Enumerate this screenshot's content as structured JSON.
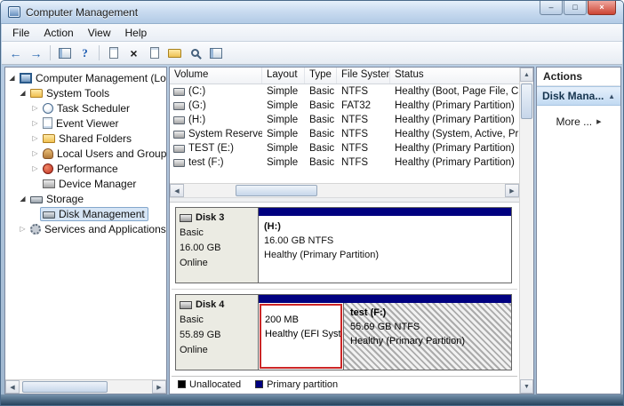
{
  "window": {
    "title": "Computer Management"
  },
  "menubar": {
    "file": "File",
    "action": "Action",
    "view": "View",
    "help": "Help"
  },
  "icons": {
    "minimize": "–",
    "maximize": "□",
    "close": "×",
    "back_arrow": "←",
    "forward_arrow": "→",
    "help": "?",
    "delete": "×",
    "expander_expanded": "◢",
    "expander_collapsed": "▷",
    "scroll_up": "▲",
    "scroll_down": "▼",
    "scroll_left": "◀",
    "scroll_right": "▶",
    "section_collapse": "▲",
    "more_arrow": "▶"
  },
  "tree": {
    "items": [
      {
        "label": "Computer Management (Local"
      },
      {
        "label": "System Tools"
      },
      {
        "label": "Task Scheduler"
      },
      {
        "label": "Event Viewer"
      },
      {
        "label": "Shared Folders"
      },
      {
        "label": "Local Users and Groups"
      },
      {
        "label": "Performance"
      },
      {
        "label": "Device Manager"
      },
      {
        "label": "Storage"
      },
      {
        "label": "Disk Management"
      },
      {
        "label": "Services and Applications"
      }
    ]
  },
  "volume_list": {
    "columns": {
      "volume": "Volume",
      "layout": "Layout",
      "type": "Type",
      "fs": "File System",
      "status": "Status"
    },
    "rows": [
      {
        "volume": "(C:)",
        "layout": "Simple",
        "type": "Basic",
        "fs": "NTFS",
        "status": "Healthy (Boot, Page File, Cr..."
      },
      {
        "volume": "(G:)",
        "layout": "Simple",
        "type": "Basic",
        "fs": "FAT32",
        "status": "Healthy (Primary Partition)"
      },
      {
        "volume": "(H:)",
        "layout": "Simple",
        "type": "Basic",
        "fs": "NTFS",
        "status": "Healthy (Primary Partition)"
      },
      {
        "volume": "System Reserved",
        "layout": "Simple",
        "type": "Basic",
        "fs": "NTFS",
        "status": "Healthy (System, Active, Pri..."
      },
      {
        "volume": "TEST (E:)",
        "layout": "Simple",
        "type": "Basic",
        "fs": "NTFS",
        "status": "Healthy (Primary Partition)"
      },
      {
        "volume": "test (F:)",
        "layout": "Simple",
        "type": "Basic",
        "fs": "NTFS",
        "status": "Healthy (Primary Partition)"
      }
    ]
  },
  "disk_view": {
    "disk3": {
      "name": "Disk 3",
      "type": "Basic",
      "size": "16.00 GB",
      "state": "Online",
      "partition": {
        "label": "(H:)",
        "size": "16.00 GB NTFS",
        "status": "Healthy (Primary Partition)"
      }
    },
    "disk4": {
      "name": "Disk 4",
      "type": "Basic",
      "size": "55.89 GB",
      "state": "Online",
      "efi": {
        "size": "200 MB",
        "status": "Healthy (EFI Syst"
      },
      "test": {
        "label": "test (F:)",
        "size": "55.69 GB NTFS",
        "status": "Healthy (Primary Partition)"
      }
    },
    "legend": {
      "unallocated": "Unallocated",
      "primary": "Primary partition",
      "unallocated_color": "#000000",
      "primary_color": "#000080",
      "selection_highlight_color": "#cc2626"
    }
  },
  "actions": {
    "title": "Actions",
    "section": "Disk Mana...",
    "more": "More ..."
  }
}
